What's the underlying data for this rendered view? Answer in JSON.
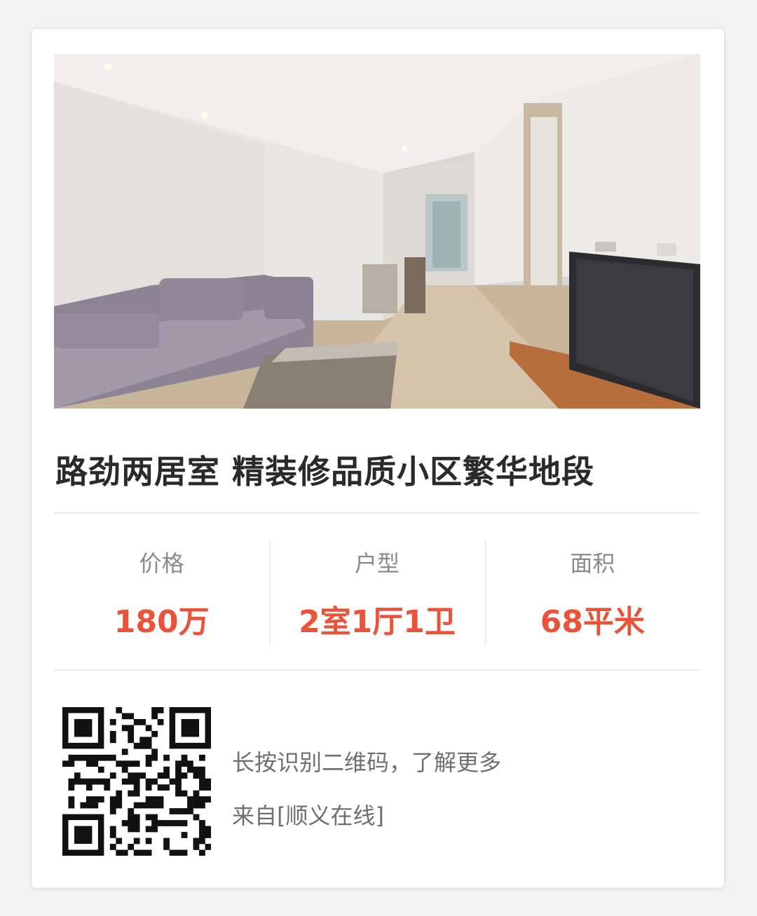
{
  "listing": {
    "title": "路劲两居室 精装修品质小区繁华地段",
    "image_alt": "living-room-photo"
  },
  "stats": [
    {
      "label": "价格",
      "value": "180万"
    },
    {
      "label": "户型",
      "value": "2室1厅1卫"
    },
    {
      "label": "面积",
      "value": "68平米"
    }
  ],
  "footer": {
    "hint": "长按识别二维码，了解更多",
    "source": "来自[顺义在线]"
  },
  "colors": {
    "accent": "#e8533a",
    "title": "#2a2a2a",
    "label": "#8a8a8a",
    "footer_text": "#6f6f6f"
  }
}
